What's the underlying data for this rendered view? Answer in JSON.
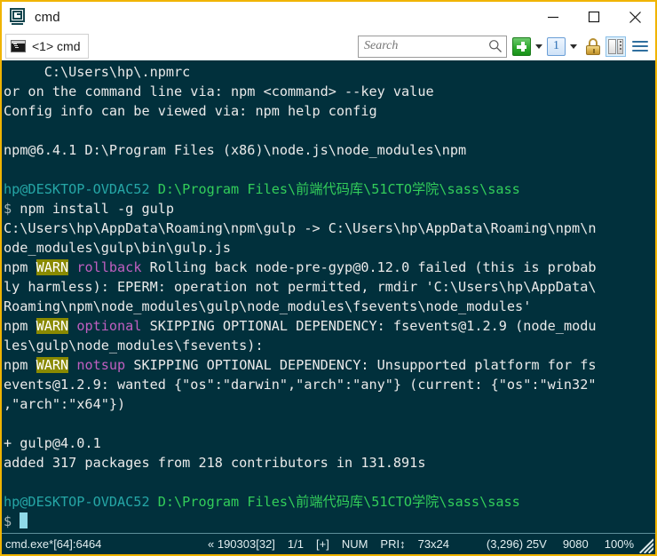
{
  "window": {
    "title": "cmd",
    "app_icon": "console-app-icon",
    "border_color": "#f0b400",
    "controls": {
      "minimize": "minimize-icon",
      "maximize": "maximize-icon",
      "close": "close-icon"
    }
  },
  "toolbar": {
    "tab": {
      "label": "<1> cmd",
      "icon": "console-tab-icon"
    },
    "search": {
      "placeholder": "Search",
      "value": "",
      "icon": "search-icon"
    },
    "buttons": {
      "new_tab": "new-tab-plus-button",
      "new_tab_caret": "new-tab-dropdown-caret",
      "workspace": "1",
      "workspace_caret": "workspace-dropdown-caret",
      "lock": "lock-icon",
      "split_pane": "split-pane-icon",
      "menu": "hamburger-menu-icon"
    }
  },
  "terminal": {
    "background": "#01303c",
    "foreground": "#eaeaea",
    "colors": {
      "green": "#32cd5a",
      "teal": "#25a6a6",
      "magenta": "#c05fc0",
      "warn_bg": "#8a8a00",
      "gray": "#a8b6b8",
      "cursor": "#8fd9e8"
    },
    "lines": [
      [
        {
          "t": "     C:\\Users\\hp\\.npmrc",
          "c": "c-white"
        }
      ],
      [
        {
          "t": "or on the command line via: npm <command> --key value",
          "c": "c-white"
        }
      ],
      [
        {
          "t": "Config info can be viewed via: npm help config",
          "c": "c-white"
        }
      ],
      [
        {
          "t": "",
          "c": "c-white"
        }
      ],
      [
        {
          "t": "npm@6.4.1 D:\\Program Files (x86)\\node.js\\node_modules\\npm",
          "c": "c-white"
        }
      ],
      [
        {
          "t": "",
          "c": "c-white"
        }
      ],
      [
        {
          "t": "hp@DESKTOP-OVDAC52",
          "c": "c-teal"
        },
        {
          "t": " D:\\Program Files\\前端代码库\\51CTO学院\\sass\\sass",
          "c": "c-green"
        }
      ],
      [
        {
          "t": "$",
          "c": "c-gray"
        },
        {
          "t": " npm install -g gulp",
          "c": "c-white"
        }
      ],
      [
        {
          "t": "C:\\Users\\hp\\AppData\\Roaming\\npm\\gulp -> C:\\Users\\hp\\AppData\\Roaming\\npm\\n",
          "c": "c-white"
        }
      ],
      [
        {
          "t": "ode_modules\\gulp\\bin\\gulp.js",
          "c": "c-white"
        }
      ],
      [
        {
          "t": "npm ",
          "c": "c-white"
        },
        {
          "t": "WARN",
          "c": "c-warn"
        },
        {
          "t": " ",
          "c": "c-white"
        },
        {
          "t": "rollback",
          "c": "c-magenta"
        },
        {
          "t": " Rolling back node-pre-gyp@0.12.0 failed (this is probab",
          "c": "c-white"
        }
      ],
      [
        {
          "t": "ly harmless): EPERM: operation not permitted, rmdir 'C:\\Users\\hp\\AppData\\",
          "c": "c-white"
        }
      ],
      [
        {
          "t": "Roaming\\npm\\node_modules\\gulp\\node_modules\\fsevents\\node_modules'",
          "c": "c-white"
        }
      ],
      [
        {
          "t": "npm ",
          "c": "c-white"
        },
        {
          "t": "WARN",
          "c": "c-warn"
        },
        {
          "t": " ",
          "c": "c-white"
        },
        {
          "t": "optional",
          "c": "c-magenta"
        },
        {
          "t": " SKIPPING OPTIONAL DEPENDENCY: fsevents@1.2.9 (node_modu",
          "c": "c-white"
        }
      ],
      [
        {
          "t": "les\\gulp\\node_modules\\fsevents):",
          "c": "c-white"
        }
      ],
      [
        {
          "t": "npm ",
          "c": "c-white"
        },
        {
          "t": "WARN",
          "c": "c-warn"
        },
        {
          "t": " ",
          "c": "c-white"
        },
        {
          "t": "notsup",
          "c": "c-magenta"
        },
        {
          "t": " SKIPPING OPTIONAL DEPENDENCY: Unsupported platform for fs",
          "c": "c-white"
        }
      ],
      [
        {
          "t": "events@1.2.9: wanted {\"os\":\"darwin\",\"arch\":\"any\"} (current: {\"os\":\"win32\"",
          "c": "c-white"
        }
      ],
      [
        {
          "t": ",\"arch\":\"x64\"})",
          "c": "c-white"
        }
      ],
      [
        {
          "t": "",
          "c": "c-white"
        }
      ],
      [
        {
          "t": "+ gulp@4.0.1",
          "c": "c-white"
        }
      ],
      [
        {
          "t": "added 317 packages from 218 contributors in 131.891s",
          "c": "c-white"
        }
      ],
      [
        {
          "t": "",
          "c": "c-white"
        }
      ],
      [
        {
          "t": "hp@DESKTOP-OVDAC52",
          "c": "c-teal"
        },
        {
          "t": " D:\\Program Files\\前端代码库\\51CTO学院\\sass\\sass",
          "c": "c-green"
        }
      ],
      [
        {
          "t": "$",
          "c": "c-gray"
        },
        {
          "t": " ",
          "c": "c-white"
        },
        {
          "t": "",
          "c": "cursor-slot"
        }
      ]
    ]
  },
  "statusbar": {
    "process": "cmd.exe*[64]:6464",
    "middle": [
      "« 190303[32]",
      "1/1",
      "[+]",
      "NUM",
      "PRI↕",
      "73x24"
    ],
    "right": [
      "(3,296) 25V",
      "9080",
      "100%"
    ],
    "grip": "resize-grip"
  }
}
